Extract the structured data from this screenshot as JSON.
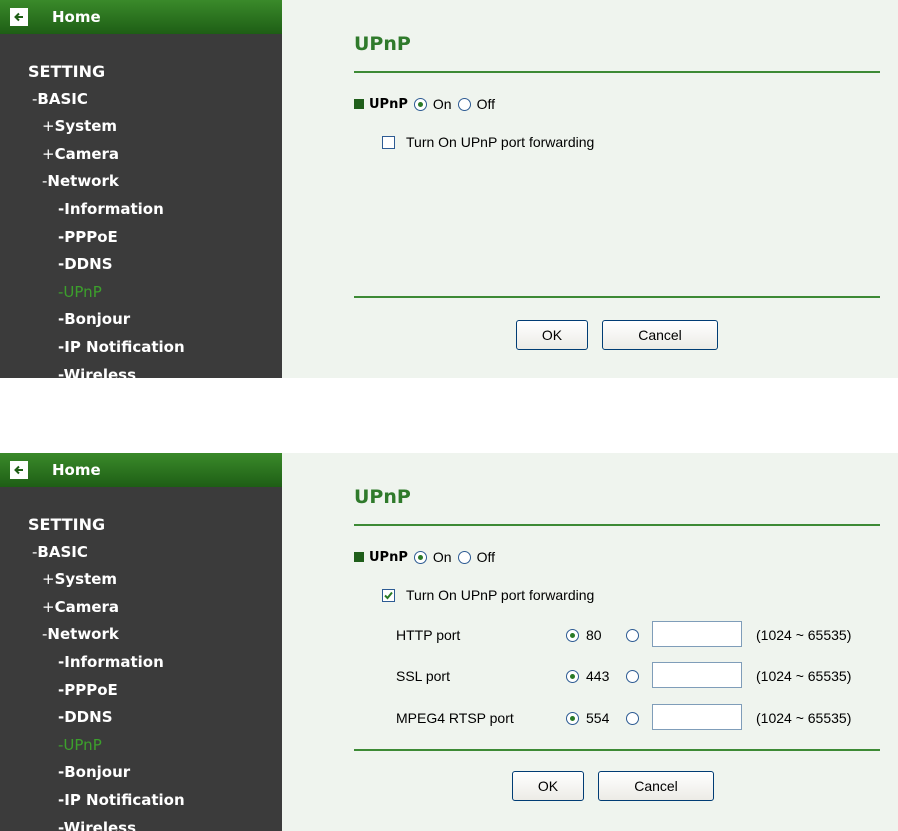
{
  "panels": [
    {
      "home_label": "Home",
      "nav": [
        {
          "prefix": "",
          "label": "SETTING"
        },
        {
          "prefix": "-",
          "label": "BASIC"
        },
        {
          "prefix": "+",
          "label": "System"
        },
        {
          "prefix": "+",
          "label": "Camera"
        },
        {
          "prefix": "-",
          "label": "Network"
        },
        {
          "prefix": "-",
          "label": "Information"
        },
        {
          "prefix": "-",
          "label": "PPPoE"
        },
        {
          "prefix": "-",
          "label": "DDNS"
        },
        {
          "prefix": "-",
          "label": "UPnP"
        },
        {
          "prefix": "-",
          "label": "Bonjour"
        },
        {
          "prefix": "-",
          "label": "IP Notification"
        },
        {
          "prefix": "-",
          "label": "Wireless"
        }
      ],
      "title": "UPnP",
      "upnp_label": "UPnP",
      "on_label": "On",
      "off_label": "Off",
      "upnp_selected": "On",
      "forwarding_label": "Turn On UPnP port forwarding",
      "forwarding_checked": false,
      "ok_label": "OK",
      "cancel_label": "Cancel"
    },
    {
      "home_label": "Home",
      "nav": [
        {
          "prefix": "",
          "label": "SETTING"
        },
        {
          "prefix": "-",
          "label": "BASIC"
        },
        {
          "prefix": "+",
          "label": "System"
        },
        {
          "prefix": "+",
          "label": "Camera"
        },
        {
          "prefix": "-",
          "label": "Network"
        },
        {
          "prefix": "-",
          "label": "Information"
        },
        {
          "prefix": "-",
          "label": "PPPoE"
        },
        {
          "prefix": "-",
          "label": "DDNS"
        },
        {
          "prefix": "-",
          "label": "UPnP"
        },
        {
          "prefix": "-",
          "label": "Bonjour"
        },
        {
          "prefix": "-",
          "label": "IP Notification"
        },
        {
          "prefix": "-",
          "label": "Wireless"
        }
      ],
      "title": "UPnP",
      "upnp_label": "UPnP",
      "on_label": "On",
      "off_label": "Off",
      "upnp_selected": "On",
      "forwarding_label": "Turn On UPnP port forwarding",
      "forwarding_checked": true,
      "ports": [
        {
          "name": "HTTP port",
          "default": "80",
          "value": "",
          "range": "(1024 ~ 65535)"
        },
        {
          "name": "SSL port",
          "default": "443",
          "value": "",
          "range": "(1024 ~ 65535)"
        },
        {
          "name": "MPEG4 RTSP port",
          "default": "554",
          "value": "",
          "range": "(1024 ~ 65535)"
        }
      ],
      "ok_label": "OK",
      "cancel_label": "Cancel"
    }
  ],
  "colors": {
    "sidebar_bg": "#3b3b3b",
    "active_nav": "#3ca02c",
    "content_bg": "#eff4ee",
    "title": "#2f7a2b",
    "rule": "#3d8a35"
  }
}
